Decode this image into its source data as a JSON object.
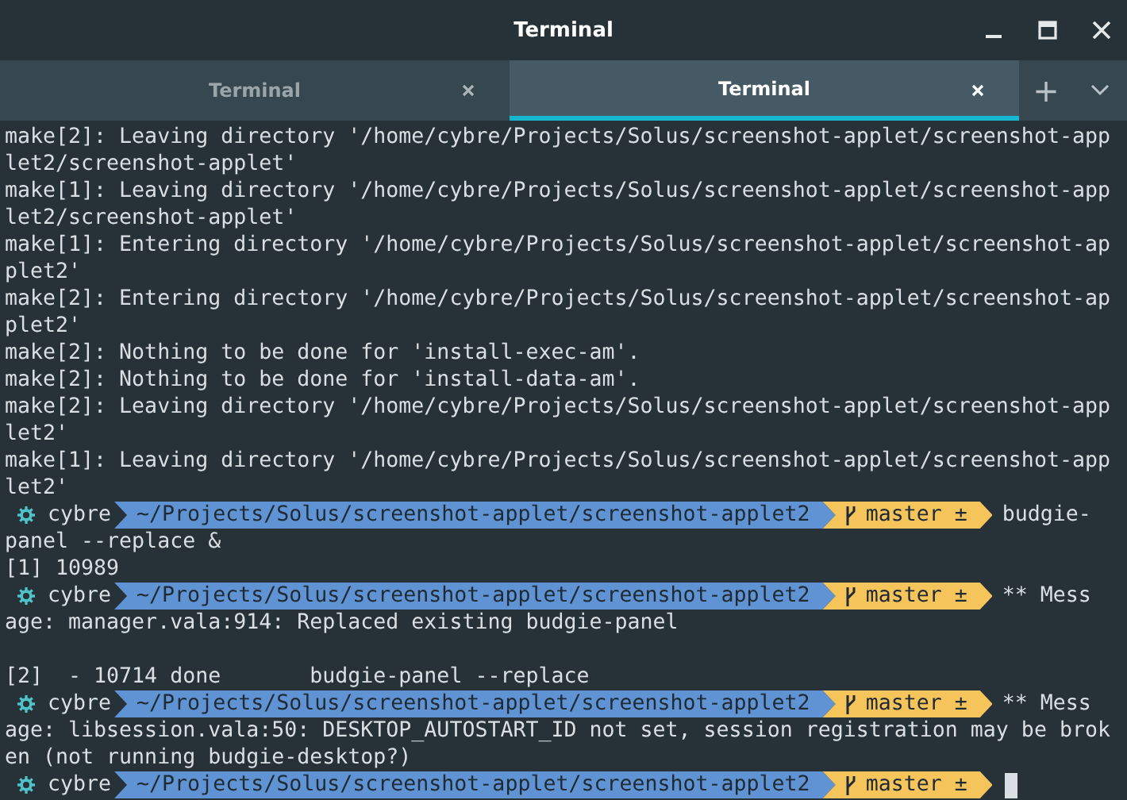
{
  "window": {
    "title": "Terminal"
  },
  "tabs": [
    {
      "label": "Terminal",
      "selected": false
    },
    {
      "label": "Terminal",
      "selected": true
    }
  ],
  "tab_actions": [
    "+"
  ],
  "terminal": {
    "lines": [
      {
        "kind": "text",
        "text": "make[2]: Leaving directory '/home/cybre/Projects/Solus/screenshot-applet/screenshot-app"
      },
      {
        "kind": "text",
        "text": "let2/screenshot-applet'"
      },
      {
        "kind": "text",
        "text": "make[1]: Leaving directory '/home/cybre/Projects/Solus/screenshot-applet/screenshot-app"
      },
      {
        "kind": "text",
        "text": "let2/screenshot-applet'"
      },
      {
        "kind": "text",
        "text": "make[1]: Entering directory '/home/cybre/Projects/Solus/screenshot-applet/screenshot-ap"
      },
      {
        "kind": "text",
        "text": "plet2'"
      },
      {
        "kind": "text",
        "text": "make[2]: Entering directory '/home/cybre/Projects/Solus/screenshot-applet/screenshot-ap"
      },
      {
        "kind": "text",
        "text": "plet2'"
      },
      {
        "kind": "text",
        "text": "make[2]: Nothing to be done for 'install-exec-am'."
      },
      {
        "kind": "text",
        "text": "make[2]: Nothing to be done for 'install-data-am'."
      },
      {
        "kind": "text",
        "text": "make[2]: Leaving directory '/home/cybre/Projects/Solus/screenshot-applet/screenshot-app"
      },
      {
        "kind": "text",
        "text": "let2'"
      },
      {
        "kind": "text",
        "text": "make[1]: Leaving directory '/home/cybre/Projects/Solus/screenshot-applet/screenshot-app"
      },
      {
        "kind": "text",
        "text": "let2'"
      },
      {
        "kind": "prompt",
        "user": "cybre",
        "path": "~/Projects/Solus/screenshot-applet/screenshot-applet2",
        "branch": "master ±",
        "text": "budgie-"
      },
      {
        "kind": "text",
        "text": "panel --replace &"
      },
      {
        "kind": "text",
        "text": "[1] 10989"
      },
      {
        "kind": "prompt",
        "user": "cybre",
        "path": "~/Projects/Solus/screenshot-applet/screenshot-applet2",
        "branch": "master ±",
        "text": "** Mess"
      },
      {
        "kind": "text",
        "text": "age: manager.vala:914: Replaced existing budgie-panel"
      },
      {
        "kind": "blank"
      },
      {
        "kind": "text",
        "text": "[2]  - 10714 done       budgie-panel --replace"
      },
      {
        "kind": "prompt",
        "user": "cybre",
        "path": "~/Projects/Solus/screenshot-applet/screenshot-applet2",
        "branch": "master ±",
        "text": "** Mess"
      },
      {
        "kind": "text",
        "text": "age: libsession.vala:50: DESKTOP_AUTOSTART_ID not set, session registration may be brok"
      },
      {
        "kind": "text",
        "text": "en (not running budgie-desktop?)"
      },
      {
        "kind": "prompt",
        "user": "cybre",
        "path": "~/Projects/Solus/screenshot-applet/screenshot-applet2",
        "branch": "master ±",
        "cursor": true
      }
    ]
  }
}
